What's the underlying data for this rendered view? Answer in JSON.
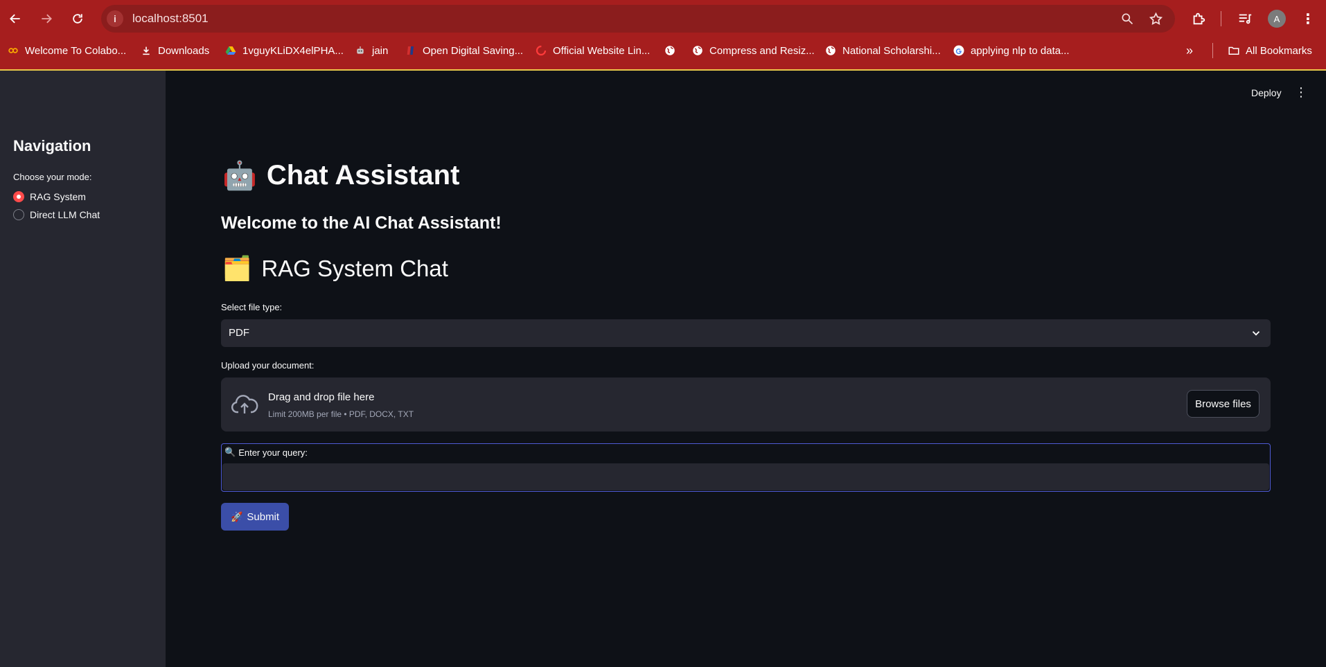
{
  "browser": {
    "url": "localhost:8501",
    "avatar_letter": "A",
    "bookmarks": [
      {
        "label": "Welcome To Colabo...",
        "icon": "colab-icon"
      },
      {
        "label": "Downloads",
        "icon": "download-icon"
      },
      {
        "label": "1vguyKLiDX4elPHA...",
        "icon": "google-drive-icon"
      },
      {
        "label": "jain",
        "icon": "robot-icon"
      },
      {
        "label": "Open Digital Saving...",
        "icon": "bank-icon"
      },
      {
        "label": "Official Website Lin...",
        "icon": "link-icon"
      },
      {
        "label": "",
        "icon": "globe-icon"
      },
      {
        "label": "Compress and Resiz...",
        "icon": "globe-icon"
      },
      {
        "label": "National Scholarshi...",
        "icon": "globe-icon"
      },
      {
        "label": "applying nlp to data...",
        "icon": "google-icon"
      }
    ],
    "all_bookmarks": "All Bookmarks"
  },
  "sidebar": {
    "title": "Navigation",
    "mode_label": "Choose your mode:",
    "options": [
      {
        "label": "RAG System",
        "selected": true
      },
      {
        "label": "Direct LLM Chat",
        "selected": false
      }
    ]
  },
  "header": {
    "deploy": "Deploy"
  },
  "main": {
    "title_emoji": "🤖",
    "title": "Chat Assistant",
    "welcome": "Welcome to the AI Chat Assistant!",
    "section_emoji": "🗂️",
    "section_title": "RAG System Chat",
    "file_type_label": "Select file type:",
    "file_type_value": "PDF",
    "upload_label": "Upload your document:",
    "upload_title": "Drag and drop file here",
    "upload_sub": "Limit 200MB per file • PDF, DOCX, TXT",
    "browse_label": "Browse files",
    "query_emoji": "🔍",
    "query_label": "Enter your query:",
    "query_value": "",
    "submit_emoji": "🚀",
    "submit_label": "Submit"
  },
  "colors": {
    "chrome": "#a61e1e",
    "sidebar_bg": "#262730",
    "main_bg": "#0e1117",
    "accent": "#ff4b4b",
    "submit_bg": "#3b4ea8"
  }
}
